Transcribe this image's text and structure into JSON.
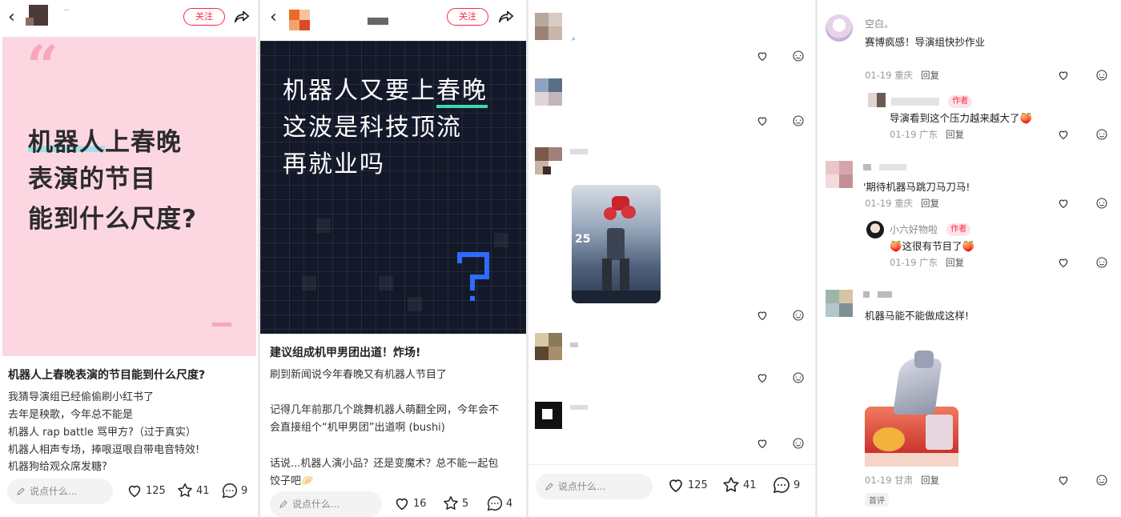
{
  "panel1": {
    "follow_label": "关注",
    "cover_lines": [
      "机器人上春晚",
      "表演的节目",
      "能到什么尺度?"
    ],
    "cover_highlight": "机器人",
    "title": "机器人上春晚表演的节目能到什么尺度?",
    "body": [
      "我猜导演组已经偷偷刷小红书了",
      "去年是秧歌，今年总不能是",
      "机器人 rap battle 骂甲方?（过于真实）",
      "机器人相声专场，捧哏逗哏自带电音特效!",
      "机器狗给观众席发糖?"
    ],
    "input_placeholder": "说点什么...",
    "likes": "125",
    "stars": "41",
    "comments": "9"
  },
  "panel2": {
    "follow_label": "关注",
    "cover_lines": [
      "机器人又要上春晚",
      "这波是科技顶流",
      "再就业吗"
    ],
    "title": "建议组成机甲男团出道！炸场!",
    "body": [
      "刷到新闻说今年春晚又有机器人节目了",
      "",
      "记得几年前那几个跳舞机器人萌翻全网，今年会不",
      "会直接组个“机甲男团”出道啊 (bushi)",
      "",
      "话说...机器人演小品？还是变魔术？总不能一起包",
      "饺子吧🥟"
    ],
    "input_placeholder": "说点什么...",
    "likes": "16",
    "stars": "5",
    "comments": "4"
  },
  "panel3": {
    "comments": "9",
    "input_placeholder": "说点什么...",
    "likes": "125",
    "stars": "41"
  },
  "panel4": {
    "comments": [
      {
        "name": "空白。",
        "text": "赛博疯感！导演组快抄作业",
        "meta": "01-19 重庆",
        "reply": "回复"
      },
      {
        "text": "导演看到这个压力越来越大了🍑",
        "meta": "01-19 广东",
        "reply": "回复",
        "tag": "作者"
      },
      {
        "text": "'期待机器马跳刀马刀马!",
        "meta": "01-19 重庆",
        "reply": "回复"
      },
      {
        "name": "小六好物啦",
        "text": "🍑这很有节目了🍑",
        "meta": "01-19 广东",
        "reply": "回复",
        "tag": "作者"
      },
      {
        "text": "机器马能不能做成这样!",
        "meta": "01-19 甘肃",
        "reply": "回复",
        "badge": "首评"
      }
    ]
  },
  "colors": {
    "accent": "#ff2442",
    "cover1_bg": "#fcd7e1",
    "cover2_bg": "#14192a",
    "teal": "#3fd6b5",
    "qmark_blue": "#2f6bff"
  }
}
